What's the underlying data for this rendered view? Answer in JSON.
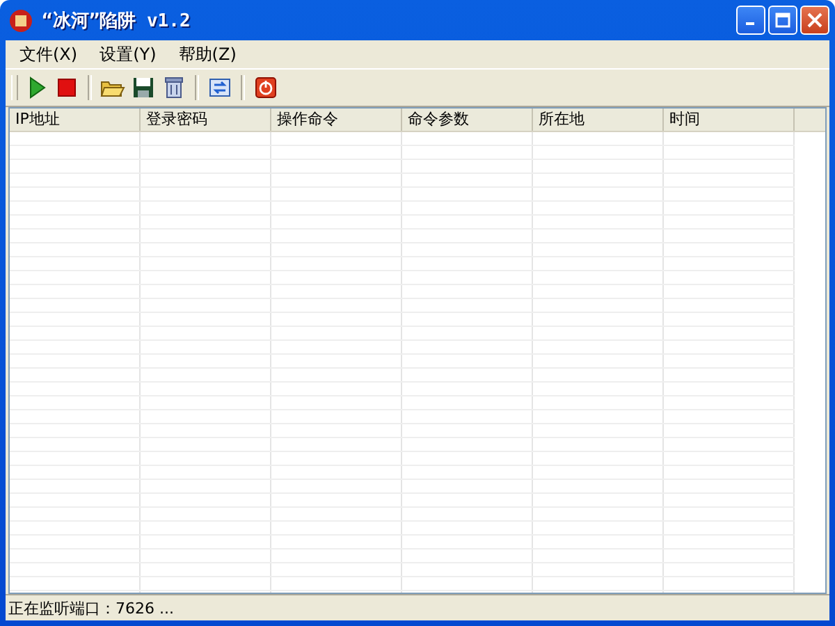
{
  "window": {
    "title": "“冰河”陷阱 v1.2"
  },
  "menu": [
    "文件(X)",
    "设置(Y)",
    "帮助(Z)"
  ],
  "table": {
    "columns": [
      "IP地址",
      "登录密码",
      "操作命令",
      "命令参数",
      "所在地",
      "时间"
    ]
  },
  "status_bar": "正在监听端口：7626 ..."
}
